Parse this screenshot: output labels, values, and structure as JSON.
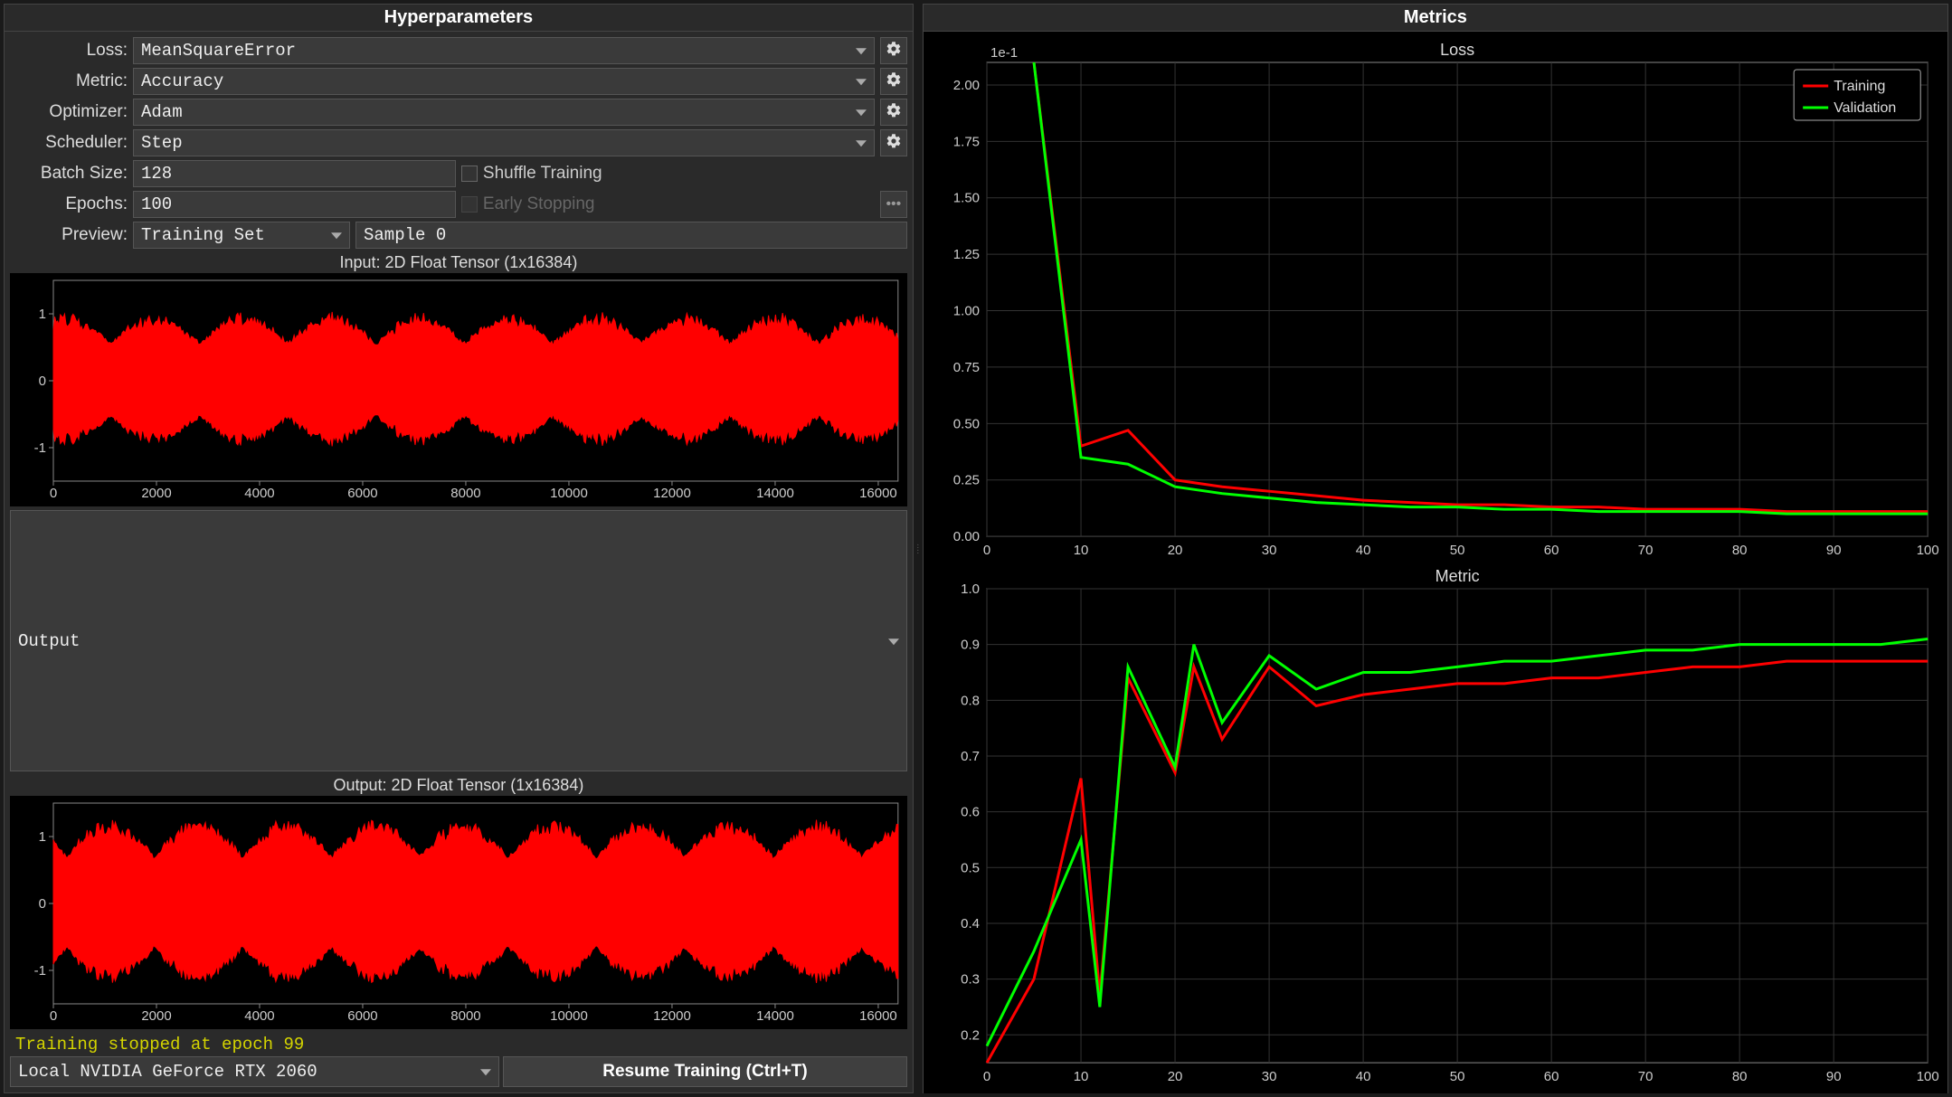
{
  "panels": {
    "left_title": "Hyperparameters",
    "right_title": "Metrics"
  },
  "form": {
    "loss_label": "Loss:",
    "loss_value": "MeanSquareError",
    "metric_label": "Metric:",
    "metric_value": "Accuracy",
    "optimizer_label": "Optimizer:",
    "optimizer_value": "Adam",
    "scheduler_label": "Scheduler:",
    "scheduler_value": "Step",
    "batch_label": "Batch Size:",
    "batch_value": "128",
    "shuffle_label": "Shuffle Training",
    "epochs_label": "Epochs:",
    "epochs_value": "100",
    "early_label": "Early Stopping",
    "preview_label": "Preview:",
    "preview_set": "Training Set",
    "preview_sample": "Sample 0"
  },
  "tensors": {
    "input_title": "Input: 2D Float Tensor (1x16384)",
    "output_title": "Output: 2D Float Tensor (1x16384)",
    "output_select": "Output",
    "x_ticks": [
      "0",
      "2000",
      "4000",
      "6000",
      "8000",
      "10000",
      "12000",
      "14000",
      "16000"
    ],
    "y_ticks": [
      "-1",
      "0",
      "1"
    ],
    "x_range": [
      0,
      16384
    ],
    "y_range": [
      -1.5,
      1.5
    ]
  },
  "status": "Training stopped at epoch 99",
  "device": "Local NVIDIA GeForce RTX 2060",
  "resume_label": "Resume Training (Ctrl+T)",
  "chart_data": [
    {
      "type": "line",
      "title": "Loss",
      "xlabel": "",
      "ylabel": "",
      "x": [
        0,
        5,
        10,
        15,
        20,
        25,
        30,
        35,
        40,
        45,
        50,
        55,
        60,
        65,
        70,
        75,
        80,
        85,
        90,
        95,
        100
      ],
      "y_multiplier_text": "1e-1",
      "ylim": [
        0,
        2.1
      ],
      "xlim": [
        0,
        100
      ],
      "y_ticks": [
        "0.00",
        "0.25",
        "0.50",
        "0.75",
        "1.00",
        "1.25",
        "1.50",
        "1.75",
        "2.00"
      ],
      "x_ticks": [
        "0",
        "10",
        "20",
        "30",
        "40",
        "50",
        "60",
        "70",
        "80",
        "90",
        "100"
      ],
      "series": [
        {
          "name": "Training",
          "color": "#ff0000",
          "values": [
            null,
            2.1,
            0.4,
            0.47,
            0.25,
            0.22,
            0.2,
            0.18,
            0.16,
            0.15,
            0.14,
            0.14,
            0.13,
            0.13,
            0.12,
            0.12,
            0.12,
            0.11,
            0.11,
            0.11,
            0.11
          ]
        },
        {
          "name": "Validation",
          "color": "#00ff00",
          "values": [
            null,
            2.1,
            0.35,
            0.32,
            0.22,
            0.19,
            0.17,
            0.15,
            0.14,
            0.13,
            0.13,
            0.12,
            0.12,
            0.11,
            0.11,
            0.11,
            0.11,
            0.1,
            0.1,
            0.1,
            0.1
          ]
        }
      ],
      "legend": {
        "show": true,
        "position": "top-right",
        "entries": [
          "Training",
          "Validation"
        ]
      }
    },
    {
      "type": "line",
      "title": "Metric",
      "xlabel": "",
      "ylabel": "",
      "x": [
        0,
        5,
        10,
        12,
        15,
        20,
        22,
        25,
        30,
        35,
        40,
        45,
        50,
        55,
        60,
        65,
        70,
        75,
        80,
        85,
        90,
        95,
        100
      ],
      "ylim": [
        0.15,
        1.0
      ],
      "xlim": [
        0,
        100
      ],
      "y_ticks": [
        "0.2",
        "0.3",
        "0.4",
        "0.5",
        "0.6",
        "0.7",
        "0.8",
        "0.9",
        "1.0"
      ],
      "x_ticks": [
        "0",
        "10",
        "20",
        "30",
        "40",
        "50",
        "60",
        "70",
        "80",
        "90",
        "100"
      ],
      "series": [
        {
          "name": "Training",
          "color": "#ff0000",
          "values": [
            0.15,
            0.3,
            0.66,
            0.27,
            0.84,
            0.67,
            0.86,
            0.73,
            0.86,
            0.79,
            0.81,
            0.82,
            0.83,
            0.83,
            0.84,
            0.84,
            0.85,
            0.86,
            0.86,
            0.87,
            0.87,
            0.87,
            0.87
          ]
        },
        {
          "name": "Validation",
          "color": "#00ff00",
          "values": [
            0.18,
            0.35,
            0.55,
            0.25,
            0.86,
            0.68,
            0.9,
            0.76,
            0.88,
            0.82,
            0.85,
            0.85,
            0.86,
            0.87,
            0.87,
            0.88,
            0.89,
            0.89,
            0.9,
            0.9,
            0.9,
            0.9,
            0.91
          ]
        }
      ],
      "legend": {
        "show": false
      }
    }
  ]
}
